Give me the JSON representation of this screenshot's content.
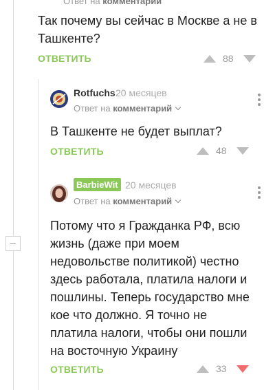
{
  "top_fragment": {
    "reply_prefix": "Ответ на",
    "reply_target": "комментарий"
  },
  "comments": [
    {
      "text": "Так почему вы сейчас в Москве а не в Ташкенте?",
      "reply_label": "ОТВЕТИТЬ",
      "votes": "88"
    },
    {
      "author": "Rotfuchs",
      "time": "20 месяцев",
      "reply_prefix": "Ответ на",
      "reply_target": "комментарий",
      "text": "В Ташкенте не будет выплат?",
      "reply_label": "ОТВЕТИТЬ",
      "votes": "48"
    },
    {
      "author": "BarbieWit",
      "time": "20 месяцев",
      "reply_prefix": "Ответ на",
      "reply_target": "комментарий",
      "text": "Потому что я Гражданка РФ, всю жизнь (даже при моем недовольстве политикой) честно здесь работала, платила налоги и пошлины. Теперь государство мне кое что должно. Я точно не платила налоги, чтобы они пошли на восточную Украину",
      "reply_label": "ОТВЕТИТЬ",
      "votes": "33"
    }
  ],
  "colors": {
    "accent": "#8ac858",
    "downvote_active": "#f36b6b"
  }
}
